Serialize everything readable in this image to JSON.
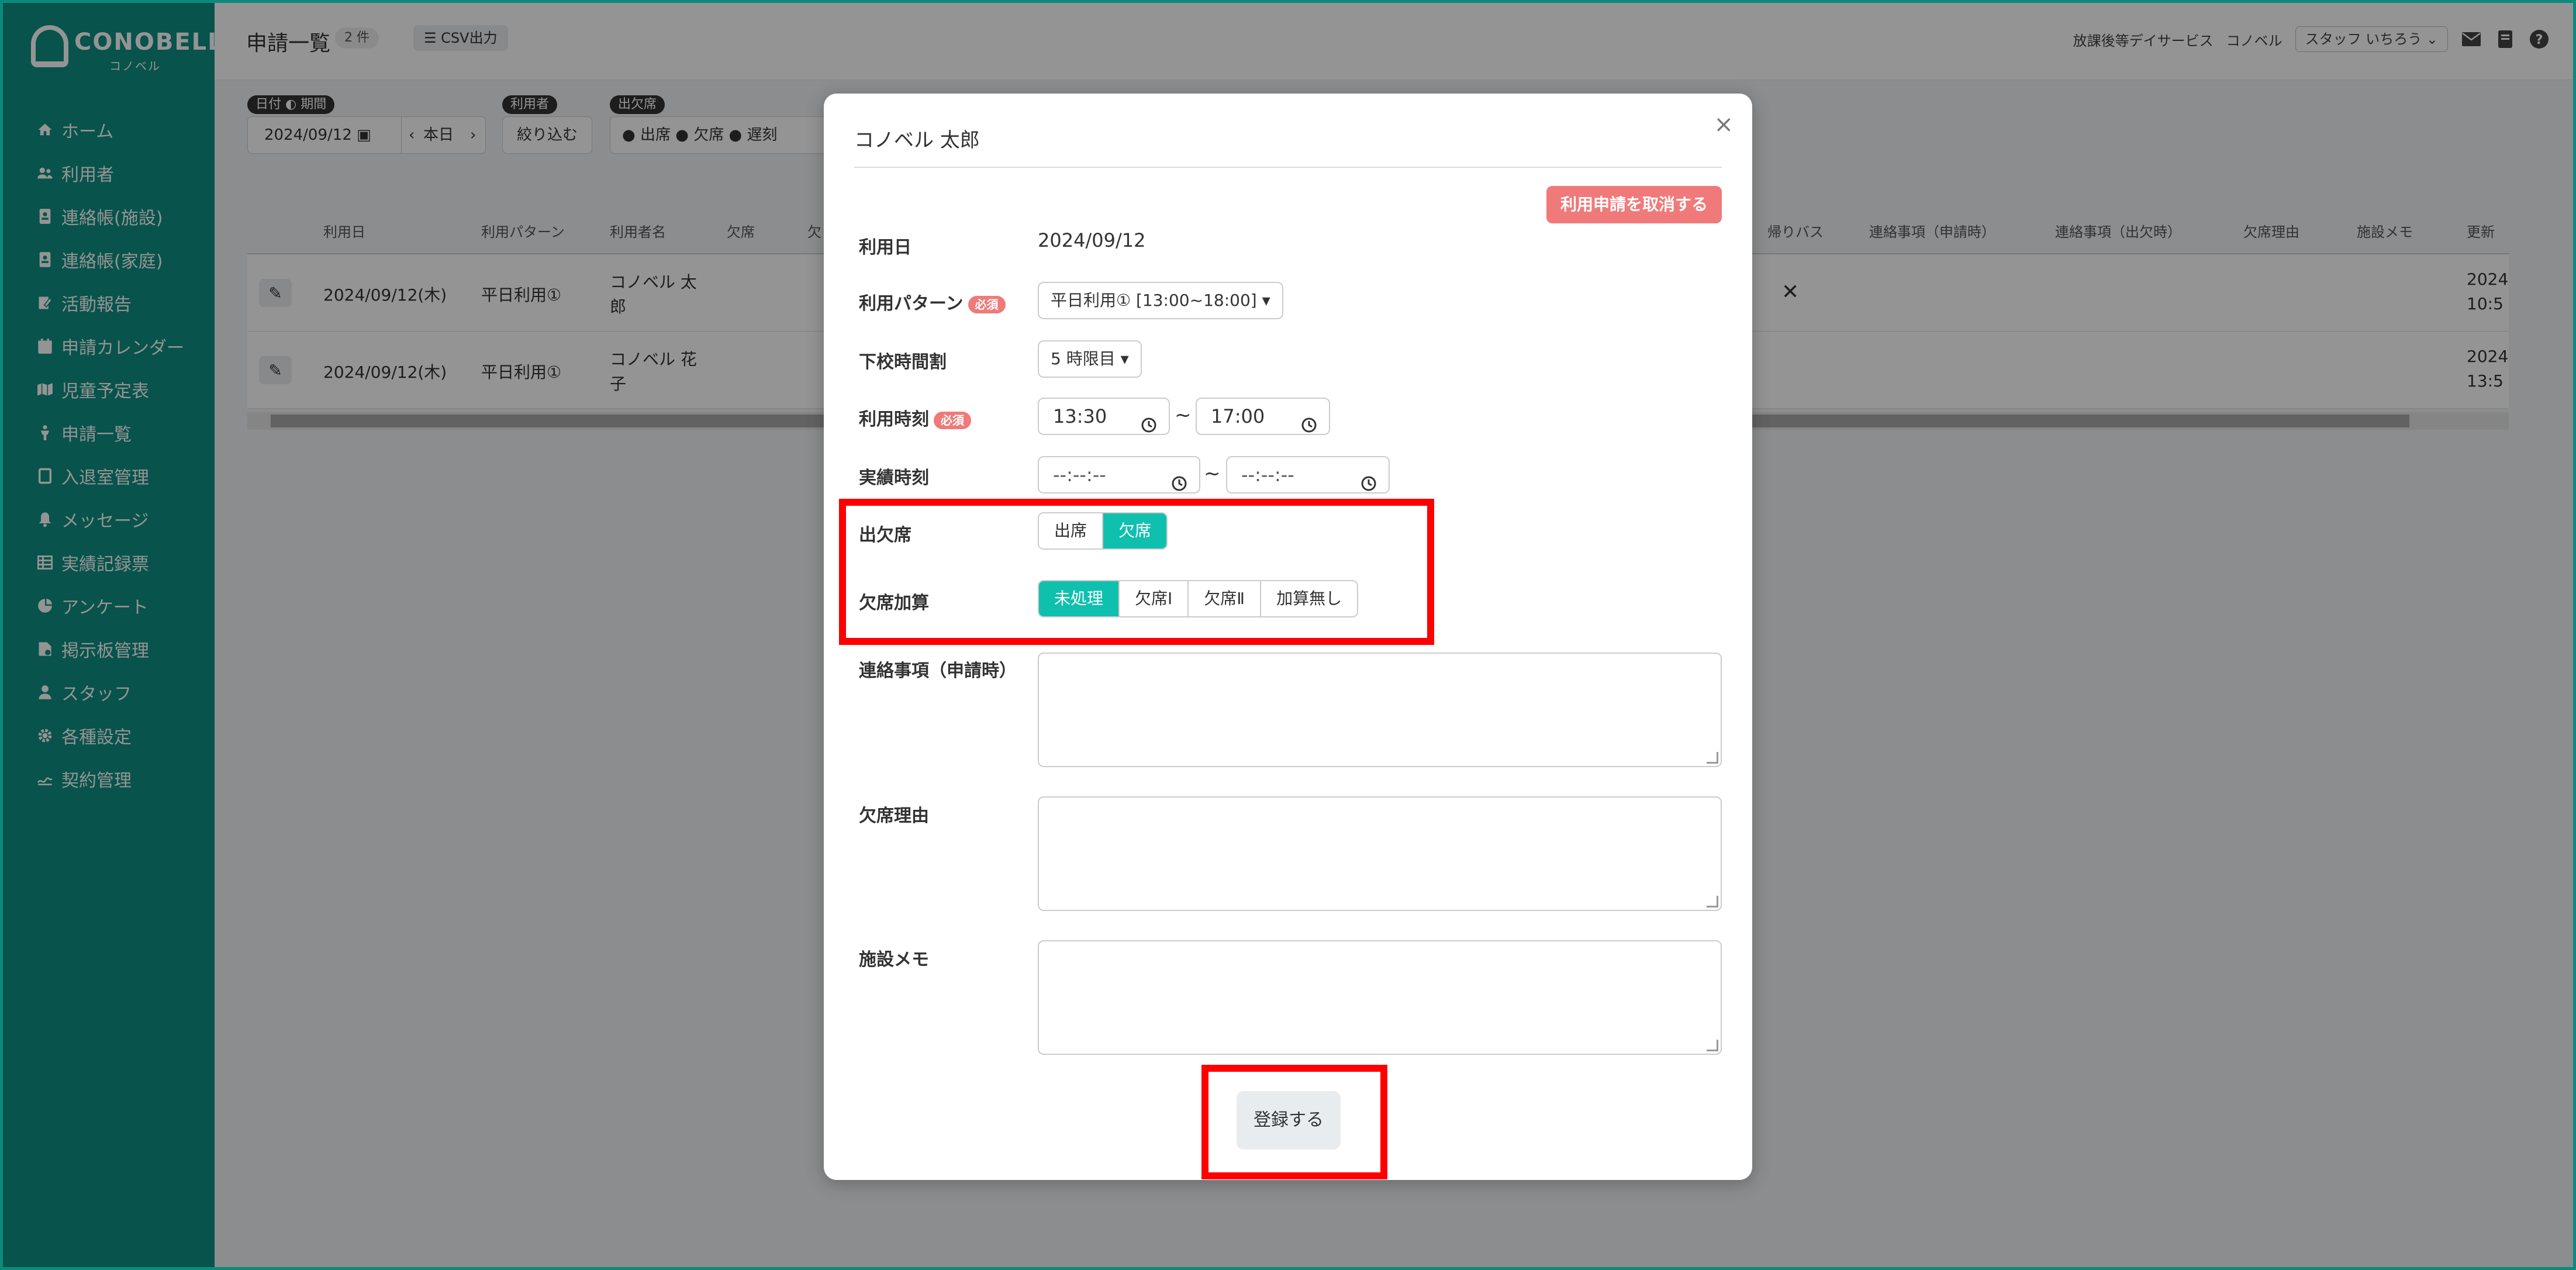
{
  "brand": {
    "name": "CONOBELL",
    "kana": "コノベル"
  },
  "sidebar": {
    "items": [
      {
        "label": "ホーム",
        "icon": "home-icon"
      },
      {
        "label": "利用者",
        "icon": "users-icon"
      },
      {
        "label": "連絡帳(施設)",
        "icon": "notebook-icon"
      },
      {
        "label": "連絡帳(家庭)",
        "icon": "notebook-icon"
      },
      {
        "label": "活動報告",
        "icon": "pen-icon"
      },
      {
        "label": "申請カレンダー",
        "icon": "calendar-icon"
      },
      {
        "label": "児童予定表",
        "icon": "map-icon"
      },
      {
        "label": "申請一覧",
        "icon": "child-icon"
      },
      {
        "label": "入退室管理",
        "icon": "door-icon"
      },
      {
        "label": "メッセージ",
        "icon": "bell-icon"
      },
      {
        "label": "実績記録票",
        "icon": "table-icon"
      },
      {
        "label": "アンケート",
        "icon": "pie-icon"
      },
      {
        "label": "掲示板管理",
        "icon": "board-icon"
      },
      {
        "label": "スタッフ",
        "icon": "person-icon"
      },
      {
        "label": "各種設定",
        "icon": "gear-icon"
      },
      {
        "label": "契約管理",
        "icon": "contract-icon"
      }
    ]
  },
  "header": {
    "title": "申請一覧",
    "count": "2 件",
    "csv_label": "CSV出力",
    "service": "放課後等デイサービス",
    "org": "コノベル",
    "staff": "スタッフ いちろう"
  },
  "filters": {
    "date_pill": "日付",
    "period_pill": "期間",
    "date_value": "2024/09/12",
    "today_label": "本日",
    "user_pill": "利用者",
    "narrow_label": "絞り込む",
    "attendance_pill": "出欠席",
    "attendance_options": [
      "出席",
      "欠席",
      "遅刻"
    ]
  },
  "table": {
    "headers": [
      "利用日",
      "利用パターン",
      "利用者名",
      "欠席",
      "欠",
      "帰りバス",
      "連絡事項（申請時）",
      "連絡事項（出欠時）",
      "欠席理由",
      "施設メモ",
      "更新"
    ],
    "rows": [
      {
        "date": "2024/09/12(木)",
        "pattern": "平日利用①",
        "name1": "コノベル 太",
        "name2": "郎",
        "bus": "✕",
        "upd1": "2024",
        "upd2": "10:5"
      },
      {
        "date": "2024/09/12(木)",
        "pattern": "平日利用①",
        "name1": "コノベル 花",
        "name2": "子",
        "bus": "",
        "upd1": "2024",
        "upd2": "13:5"
      }
    ]
  },
  "modal": {
    "title": "コノベル 太郎",
    "close": "×",
    "cancel_label": "利用申請を取消する",
    "required": "必須",
    "fields": {
      "use_date_label": "利用日",
      "use_date_value": "2024/09/12",
      "pattern_label": "利用パターン",
      "pattern_value": "平日利用① [13:00~18:00]",
      "school_label": "下校時間割",
      "school_value": "5 時限目",
      "time_label": "利用時刻",
      "time_from": "13:30",
      "time_to": "17:00",
      "actual_label": "実績時刻",
      "actual_from": "--:--:--",
      "actual_to": "--:--:--",
      "tilde": "~",
      "attendance_label": "出欠席",
      "attendance_options": [
        "出席",
        "欠席"
      ],
      "absence_add_label": "欠席加算",
      "absence_add_options": [
        "未処理",
        "欠席Ⅰ",
        "欠席Ⅱ",
        "加算無し"
      ],
      "note_label": "連絡事項（申請時）",
      "reason_label": "欠席理由",
      "memo_label": "施設メモ"
    },
    "submit_label": "登録する"
  },
  "colors": {
    "brand": "#0f8f84",
    "accent": "#10c0ae",
    "danger": "#f07a7a",
    "highlight": "#ff0000"
  }
}
